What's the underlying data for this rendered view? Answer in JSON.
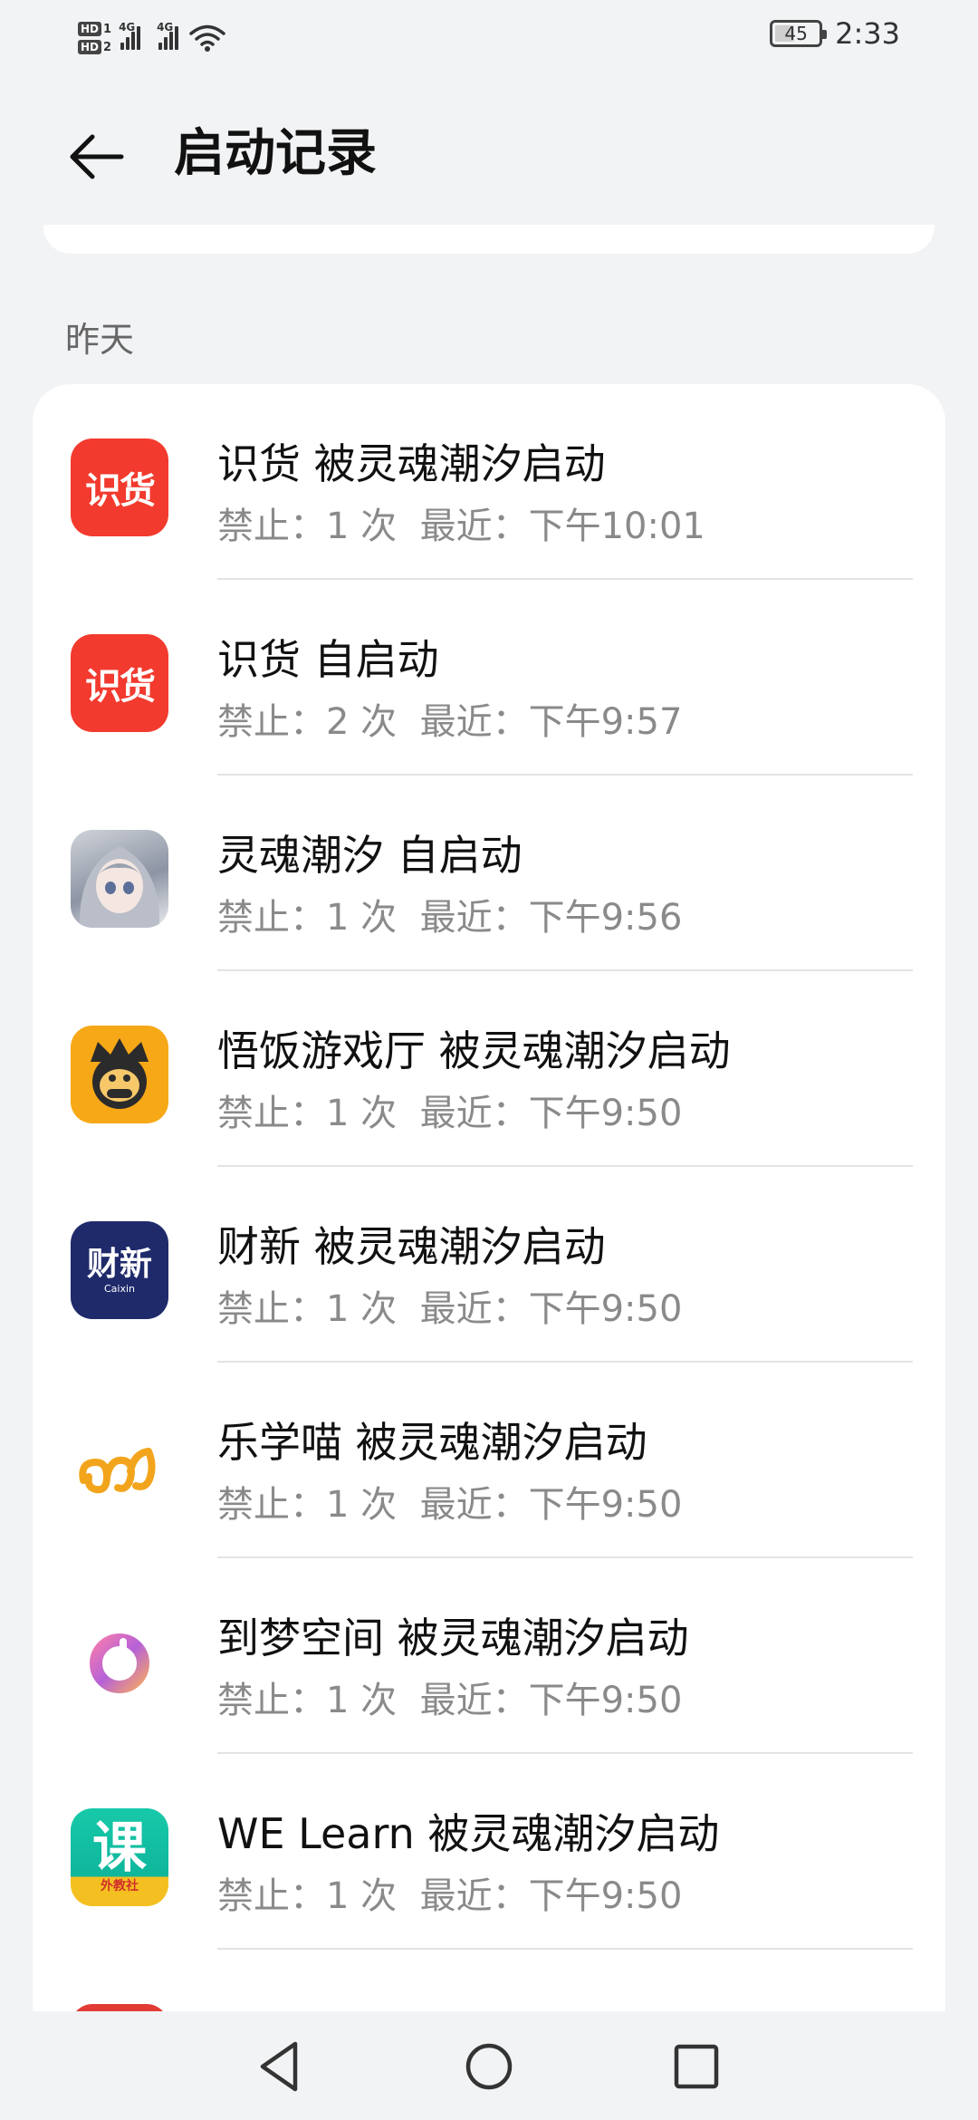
{
  "status_bar": {
    "hd1": "HD",
    "hd1_num": "1",
    "hd2": "HD",
    "hd2_num": "2",
    "network1": "4G",
    "network2": "4G",
    "battery": "45",
    "battery_level": 0.45,
    "time": "2:33"
  },
  "header": {
    "title": "启动记录",
    "back_icon": "arrow-left-icon"
  },
  "section_label": "昨天",
  "items": [
    {
      "icon": "shihuo-app-icon",
      "icon_text": "识货",
      "title": "识货 被灵魂潮汐启动",
      "blocked_label": "禁止：",
      "count": "1 次",
      "recent_label": "最近：",
      "time": "下午10:01"
    },
    {
      "icon": "shihuo-app-icon",
      "icon_text": "识货",
      "title": "识货 自启动",
      "blocked_label": "禁止：",
      "count": "2 次",
      "recent_label": "最近：",
      "time": "下午9:57"
    },
    {
      "icon": "linghun-app-icon",
      "icon_text": "",
      "title": "灵魂潮汐 自启动",
      "blocked_label": "禁止：",
      "count": "1 次",
      "recent_label": "最近：",
      "time": "下午9:56"
    },
    {
      "icon": "wufan-app-icon",
      "icon_text": "",
      "title": "悟饭游戏厅 被灵魂潮汐启动",
      "blocked_label": "禁止：",
      "count": "1 次",
      "recent_label": "最近：",
      "time": "下午9:50"
    },
    {
      "icon": "caixin-app-icon",
      "icon_text": "财新",
      "icon_subtext": "Caixin",
      "title": "财新 被灵魂潮汐启动",
      "blocked_label": "禁止：",
      "count": "1 次",
      "recent_label": "最近：",
      "time": "下午9:50"
    },
    {
      "icon": "lexuemiao-app-icon",
      "icon_text": "",
      "title": "乐学喵 被灵魂潮汐启动",
      "blocked_label": "禁止：",
      "count": "1 次",
      "recent_label": "最近：",
      "time": "下午9:50"
    },
    {
      "icon": "daomeng-app-icon",
      "icon_text": "",
      "title": "到梦空间 被灵魂潮汐启动",
      "blocked_label": "禁止：",
      "count": "1 次",
      "recent_label": "最近：",
      "time": "下午9:50"
    },
    {
      "icon": "welearn-app-icon",
      "icon_text": "课",
      "icon_subtext": "外教社",
      "title": "WE Learn 被灵魂潮汐启动",
      "blocked_label": "禁止：",
      "count": "1 次",
      "recent_label": "最近：",
      "time": "下午9:50"
    }
  ],
  "nav_bar": {
    "back": "nav-back-icon",
    "home": "nav-home-icon",
    "recents": "nav-recents-icon"
  },
  "colors": {
    "background": "#f1f3f5",
    "card": "#ffffff",
    "shihuo_red": "#f23a2e",
    "wufan_orange": "#f6a817",
    "caixin_navy": "#1f2a6b",
    "welearn_green": "#17c9a9"
  }
}
